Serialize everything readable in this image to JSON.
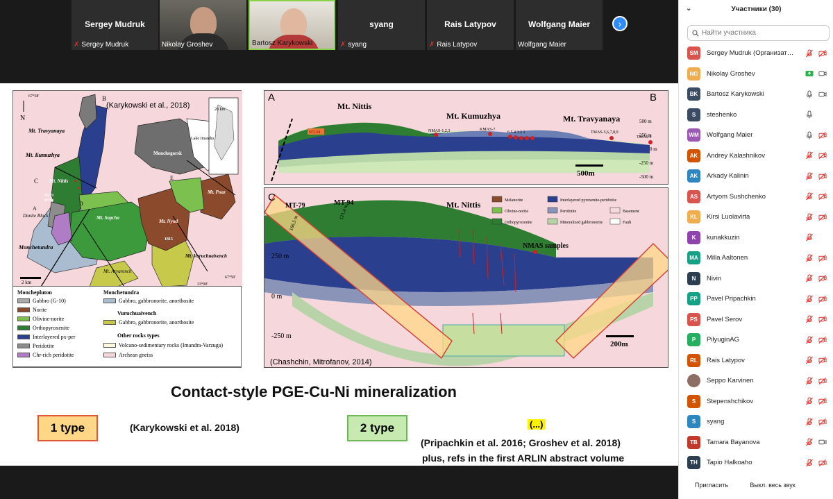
{
  "video_strip": {
    "tiles": [
      {
        "big_name": "Sergey Mudruk",
        "label": "Sergey Mudruk",
        "muted": true
      },
      {
        "big_name": "",
        "label": "Nikolay Groshev",
        "muted": false
      },
      {
        "big_name": "",
        "label": "Bartosz Karykowski",
        "muted": false
      },
      {
        "big_name": "syang",
        "label": "syang",
        "muted": true
      },
      {
        "big_name": "Rais Latypov",
        "label": "Rais Latypov",
        "muted": true
      },
      {
        "big_name": "Wolfgang Maier",
        "label": "Wolfgang Maier",
        "muted": false
      }
    ]
  },
  "slide": {
    "map_citation": "(Karykowski et al., 2018)",
    "map_labels": {
      "north": "N",
      "lat_top": "67°58'",
      "scale_inset": "20 km",
      "mt_travyanaya": "Mt. Travyanaya",
      "mt_kumuzhya": "Mt. Kumuzhya",
      "mt_nittis": "Mt. Nittis",
      "mt79": "MT79",
      "mt94": "MT94",
      "monchegorsk": "Monchegorsk",
      "lake_imandra": "Lake Imandra",
      "mt_poaz": "Mt. Poaz",
      "mt_nyud": "Mt. Nyud",
      "mt_sopcha": "Mt. Sopcha",
      "dunite_block": "Dunite Block",
      "monchetundra": "Monchetundra",
      "mt_vuruchuaivench": "Mt. Vuruchuaivench",
      "mt_arvarench": "Mt. Arvarench",
      "scale": "2 km",
      "lon": "33°00'",
      "lat_bottom": "67°50'",
      "num_1815": "1815",
      "A": "A",
      "B": "B",
      "C": "C",
      "D": "D",
      "E": "E"
    },
    "legend": {
      "group1": "Monchepluton",
      "items1": [
        "Gabbro (G-10)",
        "Norite",
        "Olivine-norite",
        "Orthopyroxenite",
        "Interlayered px-per",
        "Peridotite",
        "Chr-rich peridotite"
      ],
      "group2": "Monchetundra",
      "items2": [
        "Gabbro, gabbronorite, anorthosite"
      ],
      "group3": "Vuruchuaivench",
      "items3": [
        "Gabbro, gabbronorite, anorthosite"
      ],
      "group4": "Other rocks types",
      "items4": [
        "Volcano-sedimentary rocks (Imandra-Varzuga)",
        "Archean gneiss"
      ]
    },
    "section_ab": {
      "label_a": "A",
      "label_b": "B",
      "mt_nittis": "Mt. Nittis",
      "mt_kumuzhya": "Mt. Kumuzhya",
      "mt_travyanaya": "Mt. Travyanaya",
      "mt94": "MT-94",
      "nmas123": "NMAS-1,2,3",
      "kmas7": "KMAS-7",
      "nums": "6 5 4 3 2 1",
      "tmas": "TMAS-5,6,7,8,9",
      "tmas1": "TMAS-1",
      "y500": "500 m",
      "y250": "250 m",
      "y0": "0 m",
      "ym250": "-250 m",
      "ym500": "-500 m",
      "scale": "500m"
    },
    "section_c": {
      "label_c": "C",
      "mt79": "MT-79",
      "mt94": "MT-94",
      "mt_nittis": "Mt. Nittis",
      "depth1": "166,5 m",
      "depth2": "121,4 m",
      "nmas_samples": "NMAS samples",
      "y250": "250 m",
      "y0": "0 m",
      "ym250": "-250 m",
      "scale": "200m",
      "citation": "(Chashchin, Mitrofanov, 2014)",
      "legend": [
        "Melanorite",
        "Interlayered pyroxenite-peridotite",
        "Olivine-norite",
        "Peridotite",
        "Basement",
        "Orthopyroxenite",
        "Mineralized gabbronorite",
        "Fault"
      ]
    },
    "title": "Contact-style PGE-Cu-Ni mineralization",
    "type1": "1 type",
    "type1_ref": "(Karykowski et al. 2018)",
    "type2": "2 type",
    "ellipsis": "(...)",
    "type2_ref": "(Pripachkin et al. 2016; Groshev et al. 2018)",
    "type2_ref2": "plus, refs in the first ARLIN abstract volume"
  },
  "participants_panel": {
    "title": "Участники (30)",
    "search_placeholder": "Найти участника",
    "participants": [
      {
        "initials": "SM",
        "name": "Sergey Mudruk (Организатор, я)",
        "color": "#d9534f",
        "mic": "muted",
        "video": "off"
      },
      {
        "initials": "NG",
        "name": "Nikolay Groshev",
        "color": "#f0ad4e",
        "mic": "share",
        "video": "on"
      },
      {
        "initials": "BK",
        "name": "Bartosz Karykowski",
        "color": "#3b4b63",
        "mic": "on",
        "video": "on"
      },
      {
        "initials": "S",
        "name": "steshenko",
        "color": "#3b4b63",
        "mic": "on",
        "video": "none"
      },
      {
        "initials": "WM",
        "name": "Wolfgang Maier",
        "color": "#9b59b6",
        "mic": "on",
        "video": "off"
      },
      {
        "initials": "AK",
        "name": "Andrey Kalashnikov",
        "color": "#d35400",
        "mic": "muted",
        "video": "off"
      },
      {
        "initials": "AK",
        "name": "Arkady Kalinin",
        "color": "#2e86c1",
        "mic": "muted",
        "video": "off"
      },
      {
        "initials": "AS",
        "name": "Artyom Sushchenko",
        "color": "#d9534f",
        "mic": "muted",
        "video": "off"
      },
      {
        "initials": "KL",
        "name": "Kirsi Luolavirta",
        "color": "#f0ad4e",
        "mic": "muted",
        "video": "off"
      },
      {
        "initials": "K",
        "name": "kunakkuzin",
        "color": "#8e44ad",
        "mic": "muted",
        "video": "none"
      },
      {
        "initials": "MA",
        "name": "Milla Aaltonen",
        "color": "#16a085",
        "mic": "muted",
        "video": "off"
      },
      {
        "initials": "N",
        "name": "Nivin",
        "color": "#2c3e50",
        "mic": "muted",
        "video": "off"
      },
      {
        "initials": "PP",
        "name": "Pavel Pripachkin",
        "color": "#16a085",
        "mic": "muted",
        "video": "off"
      },
      {
        "initials": "PS",
        "name": "Pavel Serov",
        "color": "#d9534f",
        "mic": "muted",
        "video": "off"
      },
      {
        "initials": "P",
        "name": "PilyuginAG",
        "color": "#27ae60",
        "mic": "muted",
        "video": "off"
      },
      {
        "initials": "RL",
        "name": "Rais Latypov",
        "color": "#d35400",
        "mic": "muted",
        "video": "off"
      },
      {
        "initials": "",
        "name": "Seppo Karvinen",
        "color": "#8d6e63",
        "mic": "muted",
        "video": "off"
      },
      {
        "initials": "S",
        "name": "Stepenshchikov",
        "color": "#d35400",
        "mic": "muted",
        "video": "off"
      },
      {
        "initials": "S",
        "name": "syang",
        "color": "#2e86c1",
        "mic": "muted",
        "video": "off"
      },
      {
        "initials": "TB",
        "name": "Tamara Bayanova",
        "color": "#c0392b",
        "mic": "muted",
        "video": "on"
      },
      {
        "initials": "TH",
        "name": "Tapio Halkoaho",
        "color": "#2c3e50",
        "mic": "muted",
        "video": "off"
      }
    ],
    "invite_label": "Пригласить",
    "mute_all_label": "Выкл. весь звук"
  }
}
